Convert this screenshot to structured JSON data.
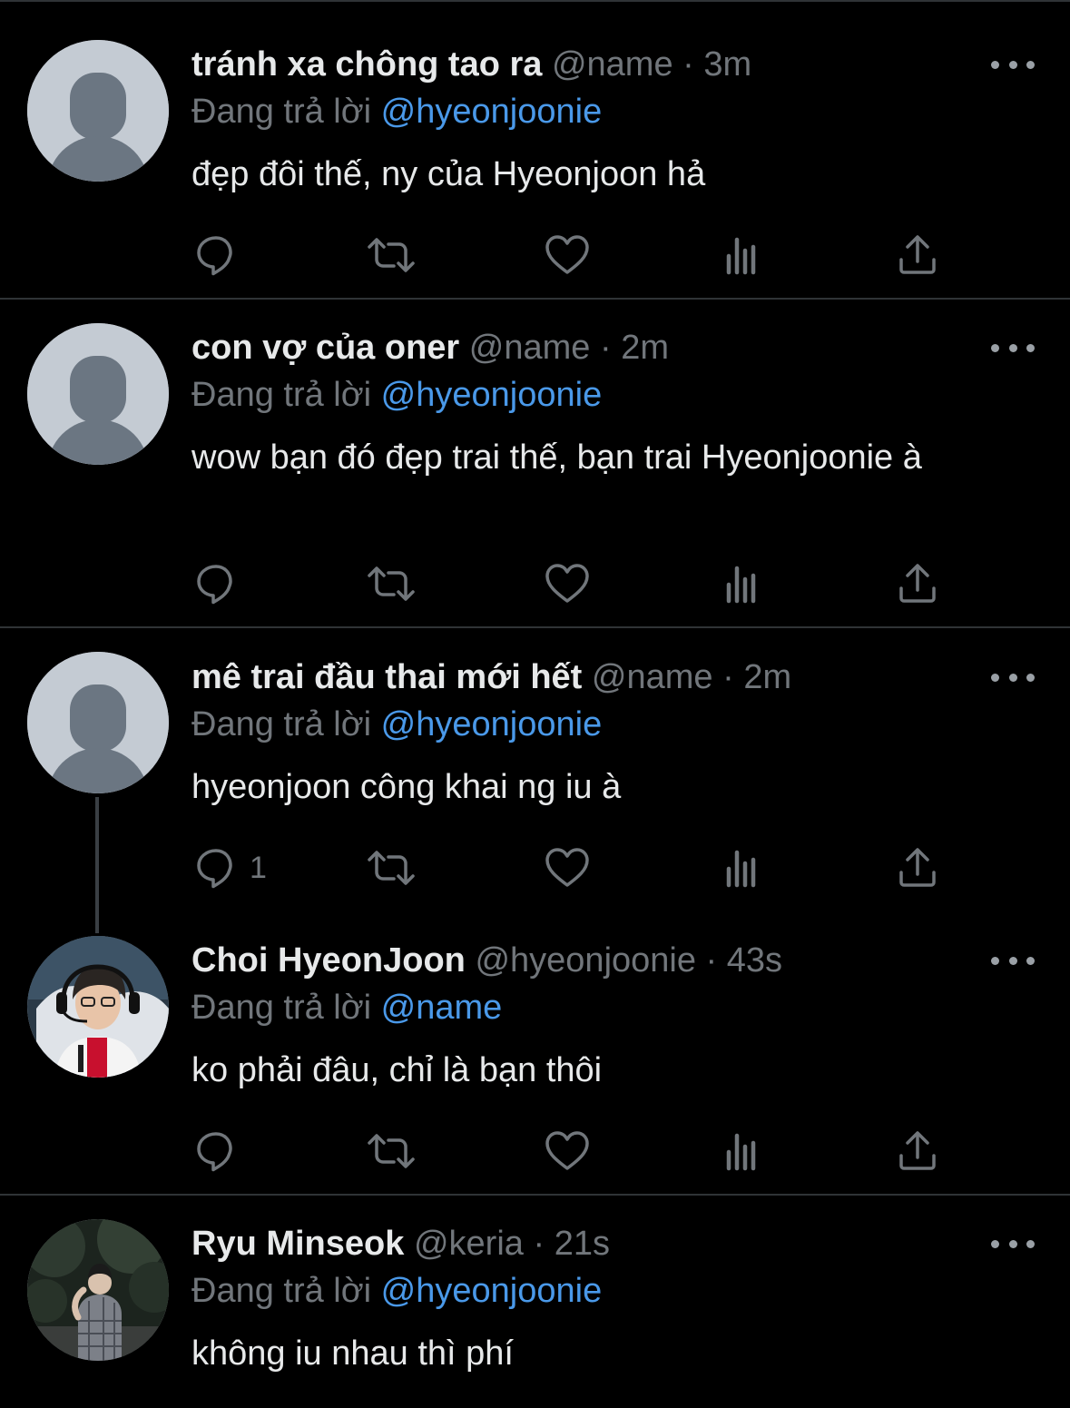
{
  "reply_prefix": "Đang trả lời",
  "icons": {
    "avatar_placeholder": "default-avatar-icon",
    "more": "more-options-icon",
    "reply": "reply-icon",
    "retweet": "retweet-icon",
    "like": "heart-icon",
    "views": "views-icon",
    "share": "share-icon"
  },
  "colors": {
    "background": "#000000",
    "name": "#e7e9ea",
    "secondary": "#71767b",
    "mention": "#4a99e9"
  },
  "tweets": [
    {
      "name": "tránh xa chông tao ra",
      "handle": "@name",
      "sep": "·",
      "time": "3m",
      "reply_to": "@hyeonjoonie",
      "text": "đẹp đôi thế, ny của Hyeonjoon hả",
      "reply_count": ""
    },
    {
      "name": "con vợ của oner",
      "handle": "@name",
      "sep": "·",
      "time": "2m",
      "reply_to": "@hyeonjoonie",
      "text": "wow bạn đó đẹp trai thế, bạn trai Hyeonjoonie à",
      "reply_count": ""
    },
    {
      "name": "mê trai đầu thai mới hết",
      "handle": "@name",
      "sep": "·",
      "time": "2m",
      "reply_to": "@hyeonjoonie",
      "text": "hyeonjoon công khai ng iu à",
      "reply_count": "1"
    },
    {
      "name": "Choi HyeonJoon",
      "handle": "@hyeonjoonie",
      "sep": "·",
      "time": "43s",
      "reply_to": "@name",
      "text": "ko phải đâu, chỉ là bạn thôi",
      "reply_count": ""
    },
    {
      "name": "Ryu Minseok",
      "handle": "@keria",
      "sep": "·",
      "time": "21s",
      "reply_to": "@hyeonjoonie",
      "text": "không iu nhau thì phí",
      "reply_count": ""
    }
  ]
}
